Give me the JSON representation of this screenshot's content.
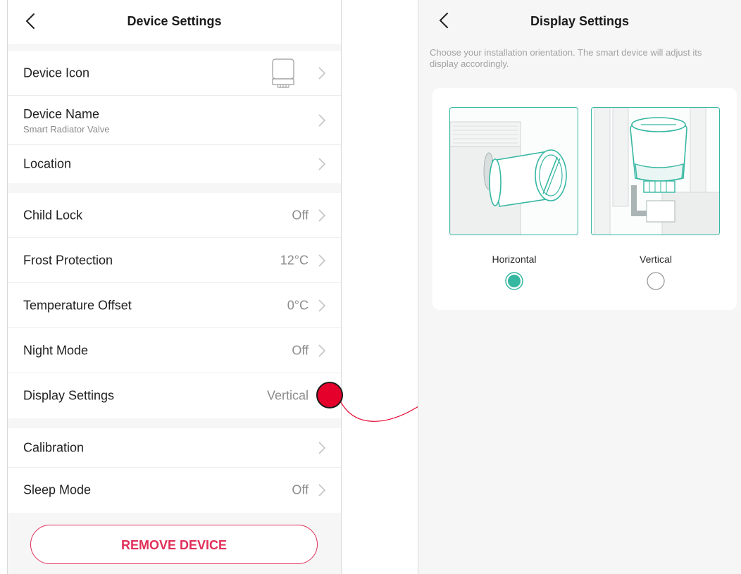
{
  "device_settings": {
    "title": "Device Settings",
    "rows": [
      {
        "label": "Device Icon",
        "value": ""
      },
      {
        "label": "Device Name",
        "sub": "Smart Radiator Valve",
        "value": ""
      },
      {
        "label": "Location",
        "value": ""
      },
      {
        "label": "Child Lock",
        "value": "Off"
      },
      {
        "label": "Frost Protection",
        "value": "12°C"
      },
      {
        "label": "Temperature Offset",
        "value": "0°C"
      },
      {
        "label": "Night Mode",
        "value": "Off"
      },
      {
        "label": "Display Settings",
        "value": "Vertical"
      },
      {
        "label": "Calibration",
        "value": ""
      },
      {
        "label": "Sleep Mode",
        "value": "Off"
      }
    ],
    "remove_label": "REMOVE DEVICE"
  },
  "display_settings": {
    "title": "Display Settings",
    "description": "Choose your installation orientation. The smart device will adjust its display accordingly.",
    "options": [
      {
        "label": "Horizontal",
        "selected": true
      },
      {
        "label": "Vertical",
        "selected": false
      }
    ]
  },
  "colors": {
    "accent": "#36b7a2",
    "danger": "#e0305a",
    "marker": "#e5002b"
  }
}
